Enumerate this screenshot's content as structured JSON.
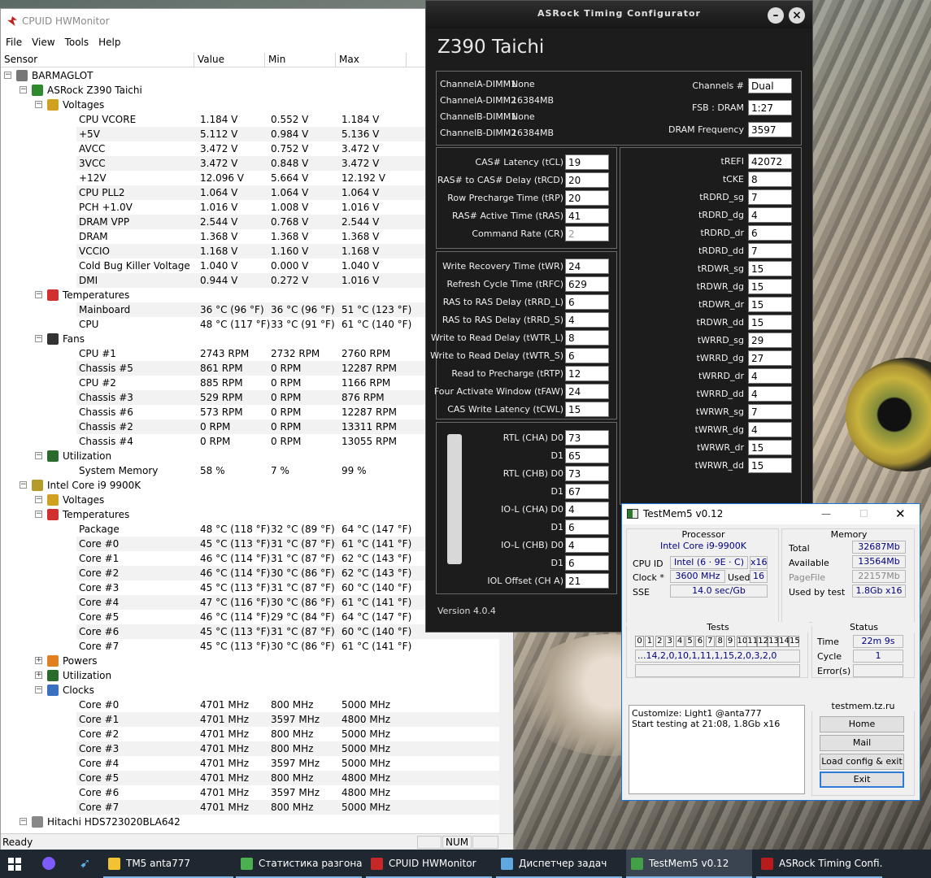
{
  "hwmonitor": {
    "title": "CPUID HWMonitor",
    "menu": [
      "File",
      "View",
      "Tools",
      "Help"
    ],
    "columns": [
      "Sensor",
      "Value",
      "Min",
      "Max"
    ],
    "status_text": "Ready",
    "status_num": "NUM",
    "tree": [
      {
        "level": 0,
        "kind": "node",
        "icon": "computer-icon",
        "name": "BARMAGLOT"
      },
      {
        "level": 1,
        "kind": "node",
        "icon": "motherboard-icon",
        "name": "ASRock Z390 Taichi"
      },
      {
        "level": 2,
        "kind": "node",
        "icon": "voltage-icon",
        "name": "Voltages"
      },
      {
        "level": 3,
        "kind": "leaf",
        "name": "CPU VCORE",
        "value": "1.184 V",
        "min": "0.552 V",
        "max": "1.184 V"
      },
      {
        "level": 3,
        "kind": "leaf",
        "name": "+5V",
        "value": "5.112 V",
        "min": "0.984 V",
        "max": "5.136 V"
      },
      {
        "level": 3,
        "kind": "leaf",
        "name": "AVCC",
        "value": "3.472 V",
        "min": "0.752 V",
        "max": "3.472 V"
      },
      {
        "level": 3,
        "kind": "leaf",
        "name": "3VCC",
        "value": "3.472 V",
        "min": "0.848 V",
        "max": "3.472 V"
      },
      {
        "level": 3,
        "kind": "leaf",
        "name": "+12V",
        "value": "12.096 V",
        "min": "5.664 V",
        "max": "12.192 V"
      },
      {
        "level": 3,
        "kind": "leaf",
        "name": "CPU PLL2",
        "value": "1.064 V",
        "min": "1.064 V",
        "max": "1.064 V"
      },
      {
        "level": 3,
        "kind": "leaf",
        "name": "PCH +1.0V",
        "value": "1.016 V",
        "min": "1.008 V",
        "max": "1.016 V"
      },
      {
        "level": 3,
        "kind": "leaf",
        "name": "DRAM VPP",
        "value": "2.544 V",
        "min": "0.768 V",
        "max": "2.544 V"
      },
      {
        "level": 3,
        "kind": "leaf",
        "name": "DRAM",
        "value": "1.368 V",
        "min": "1.368 V",
        "max": "1.368 V"
      },
      {
        "level": 3,
        "kind": "leaf",
        "name": "VCCIO",
        "value": "1.168 V",
        "min": "1.160 V",
        "max": "1.168 V"
      },
      {
        "level": 3,
        "kind": "leaf",
        "name": "Cold Bug Killer Voltage",
        "value": "1.040 V",
        "min": "0.000 V",
        "max": "1.040 V"
      },
      {
        "level": 3,
        "kind": "leaf",
        "name": "DMI",
        "value": "0.944 V",
        "min": "0.272 V",
        "max": "1.016 V"
      },
      {
        "level": 2,
        "kind": "node",
        "icon": "thermometer-icon",
        "name": "Temperatures"
      },
      {
        "level": 3,
        "kind": "leaf",
        "name": "Mainboard",
        "value": "36 °C  (96 °F)",
        "min": "36 °C  (96 °F)",
        "max": "51 °C  (123 °F)"
      },
      {
        "level": 3,
        "kind": "leaf",
        "name": "CPU",
        "value": "48 °C  (117 °F)",
        "min": "33 °C  (91 °F)",
        "max": "61 °C  (140 °F)"
      },
      {
        "level": 2,
        "kind": "node",
        "icon": "fan-icon",
        "name": "Fans"
      },
      {
        "level": 3,
        "kind": "leaf",
        "name": "CPU #1",
        "value": "2743 RPM",
        "min": "2732 RPM",
        "max": "2760 RPM"
      },
      {
        "level": 3,
        "kind": "leaf",
        "name": "Chassis #5",
        "value": "861 RPM",
        "min": "0 RPM",
        "max": "12287 RPM"
      },
      {
        "level": 3,
        "kind": "leaf",
        "name": "CPU #2",
        "value": "885 RPM",
        "min": "0 RPM",
        "max": "1166 RPM"
      },
      {
        "level": 3,
        "kind": "leaf",
        "name": "Chassis #3",
        "value": "529 RPM",
        "min": "0 RPM",
        "max": "876 RPM"
      },
      {
        "level": 3,
        "kind": "leaf",
        "name": "Chassis #6",
        "value": "573 RPM",
        "min": "0 RPM",
        "max": "12287 RPM"
      },
      {
        "level": 3,
        "kind": "leaf",
        "name": "Chassis #2",
        "value": "0 RPM",
        "min": "0 RPM",
        "max": "13311 RPM"
      },
      {
        "level": 3,
        "kind": "leaf",
        "name": "Chassis #4",
        "value": "0 RPM",
        "min": "0 RPM",
        "max": "13055 RPM"
      },
      {
        "level": 2,
        "kind": "node",
        "icon": "utilization-icon",
        "name": "Utilization"
      },
      {
        "level": 3,
        "kind": "leaf",
        "name": "System Memory",
        "value": "58 %",
        "min": "7 %",
        "max": "99 %"
      },
      {
        "level": 1,
        "kind": "node",
        "icon": "cpu-chip-icon",
        "name": "Intel Core i9 9900K"
      },
      {
        "level": 2,
        "kind": "node",
        "icon": "voltage-icon",
        "name": "Voltages"
      },
      {
        "level": 2,
        "kind": "node",
        "icon": "thermometer-icon",
        "name": "Temperatures"
      },
      {
        "level": 3,
        "kind": "leaf",
        "name": "Package",
        "value": "48 °C  (118 °F)",
        "min": "32 °C  (89 °F)",
        "max": "64 °C  (147 °F)"
      },
      {
        "level": 3,
        "kind": "leaf",
        "name": "Core #0",
        "value": "45 °C  (113 °F)",
        "min": "31 °C  (87 °F)",
        "max": "61 °C  (141 °F)"
      },
      {
        "level": 3,
        "kind": "leaf",
        "name": "Core #1",
        "value": "46 °C  (114 °F)",
        "min": "31 °C  (87 °F)",
        "max": "62 °C  (143 °F)"
      },
      {
        "level": 3,
        "kind": "leaf",
        "name": "Core #2",
        "value": "46 °C  (114 °F)",
        "min": "30 °C  (86 °F)",
        "max": "62 °C  (143 °F)"
      },
      {
        "level": 3,
        "kind": "leaf",
        "name": "Core #3",
        "value": "45 °C  (113 °F)",
        "min": "31 °C  (87 °F)",
        "max": "60 °C  (140 °F)"
      },
      {
        "level": 3,
        "kind": "leaf",
        "name": "Core #4",
        "value": "47 °C  (116 °F)",
        "min": "30 °C  (86 °F)",
        "max": "61 °C  (141 °F)"
      },
      {
        "level": 3,
        "kind": "leaf",
        "name": "Core #5",
        "value": "46 °C  (114 °F)",
        "min": "29 °C  (84 °F)",
        "max": "64 °C  (147 °F)"
      },
      {
        "level": 3,
        "kind": "leaf",
        "name": "Core #6",
        "value": "45 °C  (113 °F)",
        "min": "31 °C  (87 °F)",
        "max": "60 °C  (140 °F)"
      },
      {
        "level": 3,
        "kind": "leaf",
        "name": "Core #7",
        "value": "45 °C  (113 °F)",
        "min": "30 °C  (86 °F)",
        "max": "61 °C  (141 °F)"
      },
      {
        "level": 2,
        "kind": "node",
        "icon": "power-icon",
        "name": "Powers",
        "collapsed": true
      },
      {
        "level": 2,
        "kind": "node",
        "icon": "utilization-icon",
        "name": "Utilization",
        "collapsed": true
      },
      {
        "level": 2,
        "kind": "node",
        "icon": "clock-icon",
        "name": "Clocks"
      },
      {
        "level": 3,
        "kind": "leaf",
        "name": "Core #0",
        "value": "4701 MHz",
        "min": "800 MHz",
        "max": "5000 MHz"
      },
      {
        "level": 3,
        "kind": "leaf",
        "name": "Core #1",
        "value": "4701 MHz",
        "min": "3597 MHz",
        "max": "4800 MHz"
      },
      {
        "level": 3,
        "kind": "leaf",
        "name": "Core #2",
        "value": "4701 MHz",
        "min": "800 MHz",
        "max": "5000 MHz"
      },
      {
        "level": 3,
        "kind": "leaf",
        "name": "Core #3",
        "value": "4701 MHz",
        "min": "800 MHz",
        "max": "5000 MHz"
      },
      {
        "level": 3,
        "kind": "leaf",
        "name": "Core #4",
        "value": "4701 MHz",
        "min": "3597 MHz",
        "max": "5000 MHz"
      },
      {
        "level": 3,
        "kind": "leaf",
        "name": "Core #5",
        "value": "4701 MHz",
        "min": "800 MHz",
        "max": "4800 MHz"
      },
      {
        "level": 3,
        "kind": "leaf",
        "name": "Core #6",
        "value": "4701 MHz",
        "min": "3597 MHz",
        "max": "4800 MHz"
      },
      {
        "level": 3,
        "kind": "leaf",
        "name": "Core #7",
        "value": "4701 MHz",
        "min": "800 MHz",
        "max": "5000 MHz"
      },
      {
        "level": 1,
        "kind": "node",
        "icon": "hard-drive-icon",
        "name": "Hitachi HDS723020BLA642"
      }
    ]
  },
  "asrock": {
    "title": "ASRock Timing Configurator",
    "board": "Z390 Taichi",
    "dimms": [
      {
        "label": "ChannelA-DIMM1",
        "value": "None"
      },
      {
        "label": "ChannelA-DIMM2",
        "value": "16384MB"
      },
      {
        "label": "ChannelB-DIMM1",
        "value": "None"
      },
      {
        "label": "ChannelB-DIMM2",
        "value": "16384MB"
      }
    ],
    "info": [
      {
        "label": "Channels #",
        "value": "Dual"
      },
      {
        "label": "FSB : DRAM",
        "value": "1:27"
      },
      {
        "label": "DRAM Frequency",
        "value": "3597"
      }
    ],
    "primary": [
      {
        "label": "CAS# Latency (tCL)",
        "value": "19"
      },
      {
        "label": "RAS# to CAS# Delay (tRCD)",
        "value": "20"
      },
      {
        "label": "Row Precharge Time (tRP)",
        "value": "20"
      },
      {
        "label": "RAS# Active Time (tRAS)",
        "value": "41"
      },
      {
        "label": "Command Rate (CR)",
        "value": "2",
        "disabled": true
      }
    ],
    "secondary": [
      {
        "label": "Write Recovery Time (tWR)",
        "value": "24"
      },
      {
        "label": "Refresh Cycle Time (tRFC)",
        "value": "629"
      },
      {
        "label": "RAS to RAS Delay (tRRD_L)",
        "value": "6"
      },
      {
        "label": "RAS to RAS Delay (tRRD_S)",
        "value": "4"
      },
      {
        "label": "Write to Read Delay (tWTR_L)",
        "value": "8"
      },
      {
        "label": "Write to Read Delay (tWTR_S)",
        "value": "6"
      },
      {
        "label": "Read to Precharge (tRTP)",
        "value": "12"
      },
      {
        "label": "Four Activate Window (tFAW)",
        "value": "24"
      },
      {
        "label": "CAS Write Latency (tCWL)",
        "value": "15"
      }
    ],
    "rtl": [
      {
        "label": "RTL (CHA) D0",
        "value": "73"
      },
      {
        "label": "D1",
        "value": "65"
      },
      {
        "label": "RTL (CHB) D0",
        "value": "73"
      },
      {
        "label": "D1",
        "value": "67"
      },
      {
        "label": "IO-L (CHA) D0",
        "value": "4"
      },
      {
        "label": "D1",
        "value": "6"
      },
      {
        "label": "IO-L (CHB) D0",
        "value": "4"
      },
      {
        "label": "D1",
        "value": "6"
      },
      {
        "label": "IOL Offset (CH A)",
        "value": "21"
      }
    ],
    "tertiary": [
      {
        "label": "tREFI",
        "value": "42072"
      },
      {
        "label": "tCKE",
        "value": "8"
      },
      {
        "label": "tRDRD_sg",
        "value": "7"
      },
      {
        "label": "tRDRD_dg",
        "value": "4"
      },
      {
        "label": "tRDRD_dr",
        "value": "6"
      },
      {
        "label": "tRDRD_dd",
        "value": "7"
      },
      {
        "label": "tRDWR_sg",
        "value": "15"
      },
      {
        "label": "tRDWR_dg",
        "value": "15"
      },
      {
        "label": "tRDWR_dr",
        "value": "15"
      },
      {
        "label": "tRDWR_dd",
        "value": "15"
      },
      {
        "label": "tWRRD_sg",
        "value": "29"
      },
      {
        "label": "tWRRD_dg",
        "value": "27"
      },
      {
        "label": "tWRRD_dr",
        "value": "4"
      },
      {
        "label": "tWRRD_dd",
        "value": "4"
      },
      {
        "label": "tWRWR_sg",
        "value": "7"
      },
      {
        "label": "tWRWR_dg",
        "value": "4"
      },
      {
        "label": "tWRWR_dr",
        "value": "15"
      },
      {
        "label": "tWRWR_dd",
        "value": "15"
      }
    ],
    "version": "Version 4.0.4"
  },
  "testmem": {
    "title": "TestMem5 v0.12",
    "processor_title": "Processor",
    "processor_name": "Intel Core i9-9900K",
    "cpu_id_label": "CPU ID",
    "cpu_id_value": "Intel  (6 · 9E · C)",
    "cpu_id_threads": "x16",
    "clock_label": "Clock *",
    "clock_value": "3600 MHz",
    "used_label": "Used",
    "used_value": "16",
    "sse_label": "SSE",
    "sse_value": "14.0 sec/Gb",
    "memory_title": "Memory",
    "memory": [
      {
        "label": "Total",
        "value": "32687Mb",
        "dim": false
      },
      {
        "label": "Available",
        "value": "13564Mb",
        "dim": false
      },
      {
        "label": "PageFile",
        "value": "22157Mb",
        "dim": true
      },
      {
        "label": "Used by test",
        "value": "1.8Gb x16",
        "dim": false
      }
    ],
    "tests_title": "Tests",
    "test_numbers": [
      "0",
      "1",
      "2",
      "3",
      "4",
      "5",
      "6",
      "7",
      "8",
      "9",
      "10",
      "11",
      "12",
      "13",
      "14",
      "15"
    ],
    "test_sequence": "...14,2,0,10,1,11,1,15,2,0,3,2,0",
    "status_title": "Status",
    "status": [
      {
        "label": "Time",
        "value": "22m 9s"
      },
      {
        "label": "Cycle",
        "value": "1"
      },
      {
        "label": "Error(s)",
        "value": ""
      }
    ],
    "log": [
      "Customize: Light1 @anta777",
      "Start testing at 21:08, 1.8Gb x16"
    ],
    "site": "testmem.tz.ru",
    "buttons": [
      "Home",
      "Mail",
      "Load config & exit",
      "Exit"
    ]
  },
  "taskbar": {
    "items": [
      {
        "label": "TM5 anta777",
        "icon": "folder-icon"
      },
      {
        "label": "Статистика разгона ...",
        "icon": "chrome-icon"
      },
      {
        "label": "CPUID HWMonitor",
        "icon": "hwmonitor-icon"
      },
      {
        "label": "Диспетчер задач",
        "icon": "task-manager-icon"
      },
      {
        "label": "TestMem5 v0.12",
        "icon": "testmem-icon"
      },
      {
        "label": "ASRock Timing Confi...",
        "icon": "asrock-icon"
      }
    ]
  },
  "colors": {
    "asrock_bg": "#1c1c1c",
    "testmem_value": "#000080",
    "taskbar": "#1f2730",
    "selection_accent": "#2b7bd8"
  }
}
